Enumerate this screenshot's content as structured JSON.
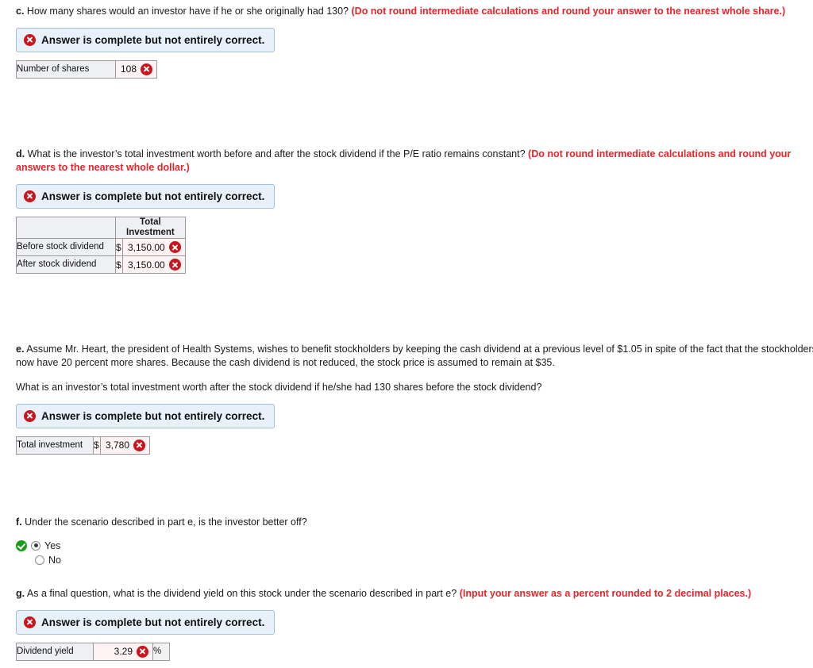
{
  "banner_text": "Answer is complete but not entirely correct.",
  "parts": {
    "c": {
      "label": "c.",
      "question": "How many shares would an investor have if he or she originally had 130?",
      "note": "(Do not round intermediate calculations and round your answer to the nearest whole share.)",
      "row_label": "Number of shares",
      "value": "108"
    },
    "d": {
      "label": "d.",
      "question": "What is the investor’s total investment worth before and after the stock dividend if the P/E ratio remains constant?",
      "note": "(Do not round intermediate calculations and round your answers to the nearest whole dollar.)",
      "col_header_line1": "Total",
      "col_header_line2": "Investment",
      "rows": [
        {
          "label": "Before stock dividend",
          "currency": "$",
          "value": "3,150.00"
        },
        {
          "label": "After stock dividend",
          "currency": "$",
          "value": "3,150.00"
        }
      ]
    },
    "e": {
      "label": "e.",
      "question": "Assume Mr. Heart, the president of Health Systems, wishes to benefit stockholders by keeping the cash dividend at a previous level of $1.05 in spite of the fact that the stockholders now have 20 percent more shares. Because the cash dividend is not reduced, the stock price is assumed to remain at $35.",
      "subquestion": "What is an investor’s total investment worth after the stock dividend if he/she had 130 shares before the stock dividend?",
      "row_label": "Total investment",
      "currency": "$",
      "value": "3,780"
    },
    "f": {
      "label": "f.",
      "question": "Under the scenario described in part e, is the investor better off?",
      "options": [
        {
          "label": "Yes",
          "selected": true
        },
        {
          "label": "No",
          "selected": false
        }
      ]
    },
    "g": {
      "label": "g.",
      "question": "As a final question, what is the dividend yield on this stock under the scenario described in part e?",
      "note": "(Input your answer as a percent rounded to 2 decimal places.)",
      "row_label": "Dividend yield",
      "value": "3.29",
      "unit": "%"
    }
  }
}
